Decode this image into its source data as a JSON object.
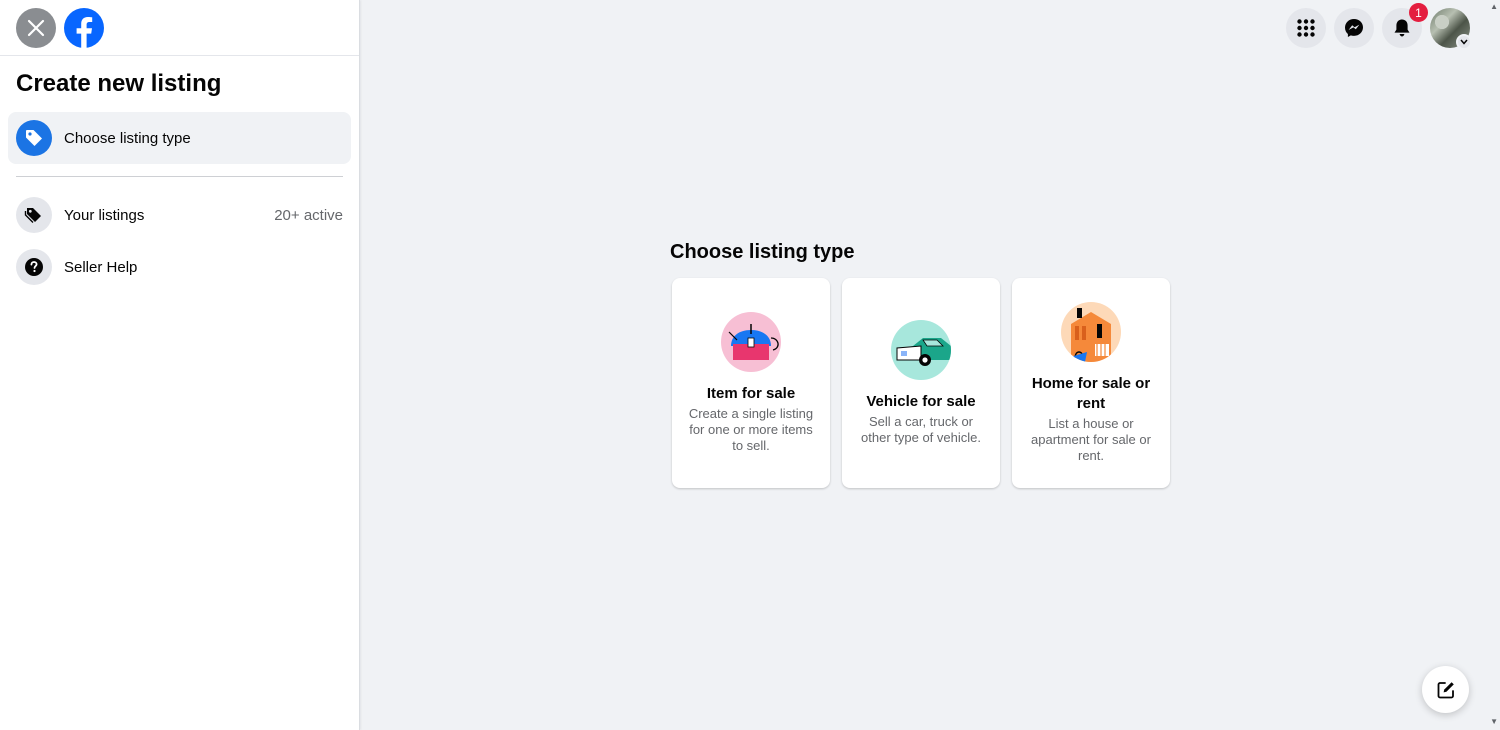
{
  "sidebar": {
    "title": "Create new listing",
    "active_item": {
      "label": "Choose listing type",
      "icon": "tag-icon"
    },
    "items": [
      {
        "label": "Your listings",
        "meta": "20+ active",
        "icon": "tags-icon"
      },
      {
        "label": "Seller Help",
        "meta": "",
        "icon": "question-icon"
      }
    ]
  },
  "topnav": {
    "notification_count": "1",
    "icons": [
      "menu-grid-icon",
      "messenger-icon",
      "bell-icon",
      "avatar"
    ]
  },
  "main": {
    "title": "Choose listing type",
    "cards": [
      {
        "title": "Item for sale",
        "desc": "Create a single listing for one or more items to sell.",
        "icon": "kettle-illustration",
        "bg": "#f7bfd4"
      },
      {
        "title": "Vehicle for sale",
        "desc": "Sell a car, truck or other type of vehicle.",
        "icon": "car-illustration",
        "bg": "#a7e7dc"
      },
      {
        "title": "Home for sale or rent",
        "desc": "List a house or apartment for sale or rent.",
        "icon": "house-illustration",
        "bg": "#fdd9b8"
      }
    ]
  },
  "colors": {
    "accent": "#1b74e4",
    "badge": "#e41e3f",
    "background": "#f0f2f5"
  }
}
